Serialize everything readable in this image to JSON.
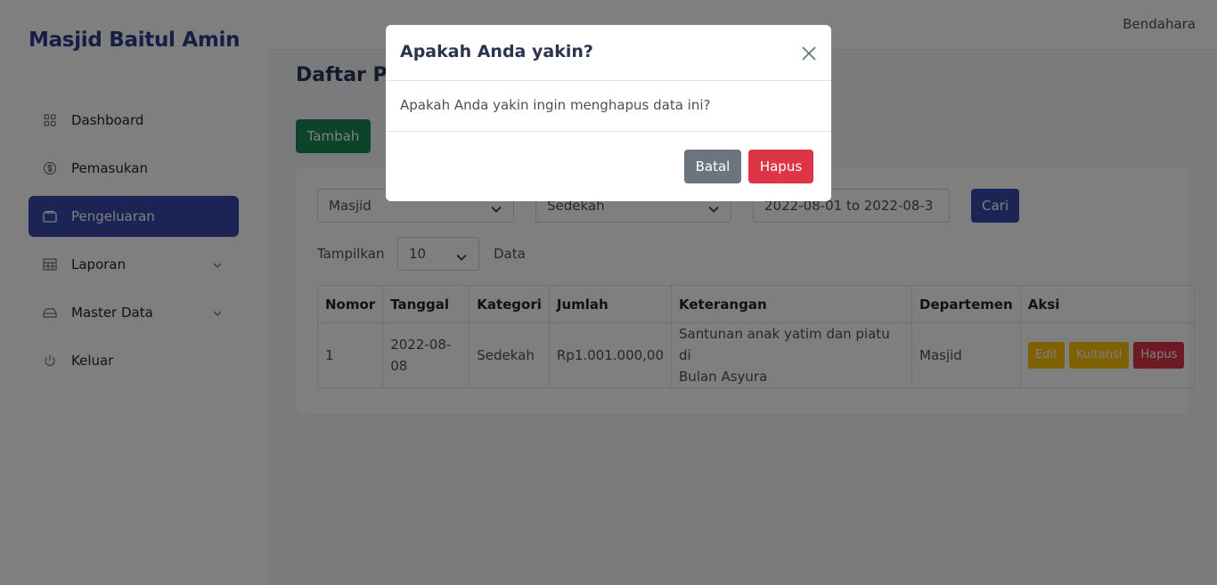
{
  "brand": "Masjid Baitul Amin",
  "user": "Bendahara",
  "sidebar": {
    "items": [
      {
        "label": "Dashboard",
        "icon": "grid-icon"
      },
      {
        "label": "Pemasukan",
        "icon": "dollar-circle-icon"
      },
      {
        "label": "Pengeluaran",
        "icon": "wallet-icon",
        "active": true
      },
      {
        "label": "Laporan",
        "icon": "table-icon"
      },
      {
        "label": "Master Data",
        "icon": "drive-icon"
      },
      {
        "label": "Keluar",
        "icon": "power-icon"
      }
    ]
  },
  "page": {
    "title": "Daftar Pe",
    "add_button": "Tambah"
  },
  "filters": {
    "departemen": "Masjid",
    "kategori": "Sedekah",
    "date_range": "2022-08-01 to 2022-08-3",
    "search_button": "Cari",
    "show_prefix": "Tampilkan",
    "page_size": "10",
    "show_suffix": "Data"
  },
  "table": {
    "headers": [
      "Nomor",
      "Tanggal",
      "Kategori",
      "Jumlah",
      "Keterangan",
      "Departemen",
      "Aksi"
    ],
    "rows": [
      {
        "nomor": "1",
        "tanggal_line1": "2022-08-",
        "tanggal_line2": "08",
        "kategori": "Sedekah",
        "jumlah": "Rp1.001.000,00",
        "keterangan_line1": "Santunan anak yatim dan piatu di",
        "keterangan_line2": "Bulan Asyura",
        "departemen": "Masjid",
        "actions": {
          "edit": "Edit",
          "kuitansi": "Kuitansi",
          "hapus": "Hapus"
        }
      }
    ]
  },
  "modal": {
    "title": "Apakah Anda yakin?",
    "body": "Apakah Anda yakin ingin menghapus data ini?",
    "cancel": "Batal",
    "confirm": "Hapus"
  },
  "colors": {
    "primary": "#3648ab",
    "success": "#198754",
    "warning": "#ffc107",
    "danger": "#dc3545",
    "secondary": "#6c757d"
  }
}
